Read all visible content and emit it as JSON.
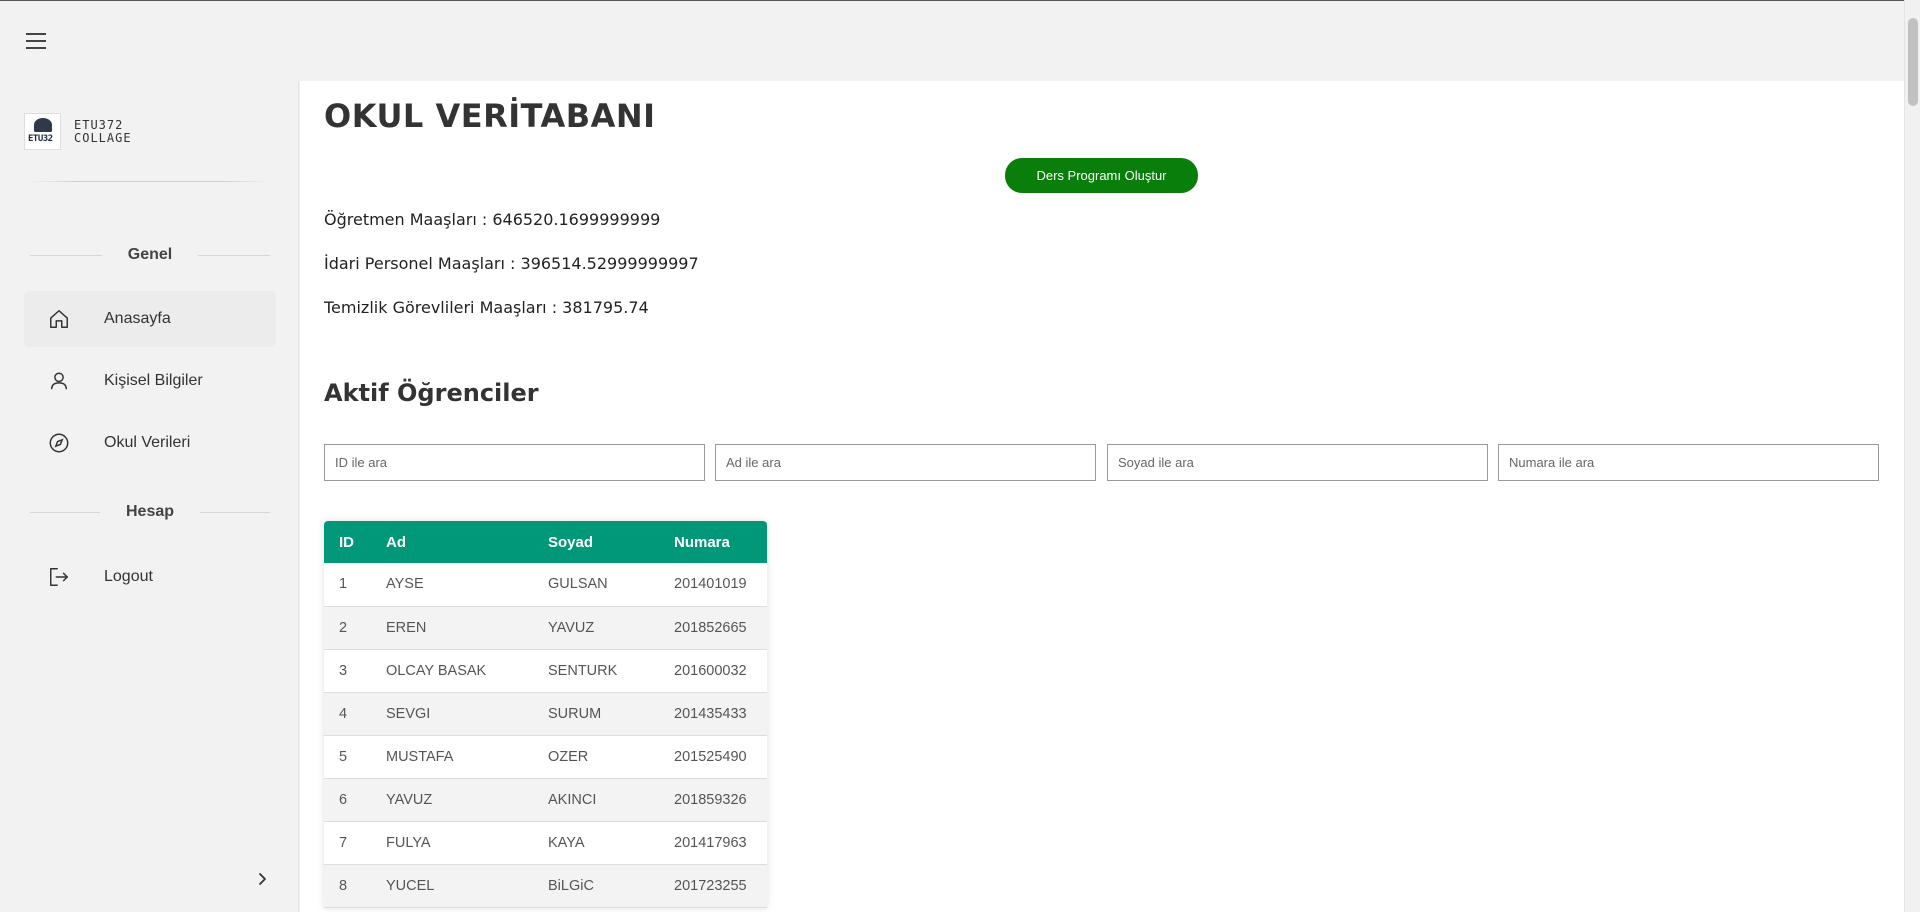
{
  "sidebar": {
    "brand_name_line1": "ETU372",
    "brand_name_line2": "COLLAGE",
    "logo_text": "ETU32",
    "sections": [
      {
        "label": "Genel"
      },
      {
        "label": "Hesap"
      }
    ],
    "items": [
      {
        "label": "Anasayfa",
        "icon": "home-icon"
      },
      {
        "label": "Kişisel Bilgiler",
        "icon": "user-icon"
      },
      {
        "label": "Okul Verileri",
        "icon": "compass-icon"
      },
      {
        "label": "Logout",
        "icon": "logout-icon"
      }
    ]
  },
  "main": {
    "title": "OKUL VERİTABANI",
    "schedule_button": "Ders Programı Oluştur",
    "stats": [
      "Öğretmen Maaşları : 646520.1699999999",
      "İdari Personel Maaşları : 396514.52999999997",
      "Temizlik Görevlileri Maaşları : 381795.74"
    ],
    "students_title": "Aktif Öğrenciler",
    "search": {
      "id_placeholder": "ID ile ara",
      "ad_placeholder": "Ad ile ara",
      "soyad_placeholder": "Soyad ile ara",
      "numara_placeholder": "Numara ile ara"
    },
    "table": {
      "headers": [
        "ID",
        "Ad",
        "Soyad",
        "Numara"
      ],
      "rows": [
        [
          "1",
          "AYSE",
          "GULSAN",
          "201401019"
        ],
        [
          "2",
          "EREN",
          "YAVUZ",
          "201852665"
        ],
        [
          "3",
          "OLCAY BASAK",
          "SENTURK",
          "201600032"
        ],
        [
          "4",
          "SEVGI",
          "SURUM",
          "201435433"
        ],
        [
          "5",
          "MUSTAFA",
          "OZER",
          "201525490"
        ],
        [
          "6",
          "YAVUZ",
          "AKINCI",
          "201859326"
        ],
        [
          "7",
          "FULYA",
          "KAYA",
          "201417963"
        ],
        [
          "8",
          "YUCEL",
          "BiLGiC",
          "201723255"
        ]
      ]
    }
  },
  "colors": {
    "table_header": "#009879",
    "button_green": "#0a7e0a",
    "background": "#f2f2f2"
  }
}
